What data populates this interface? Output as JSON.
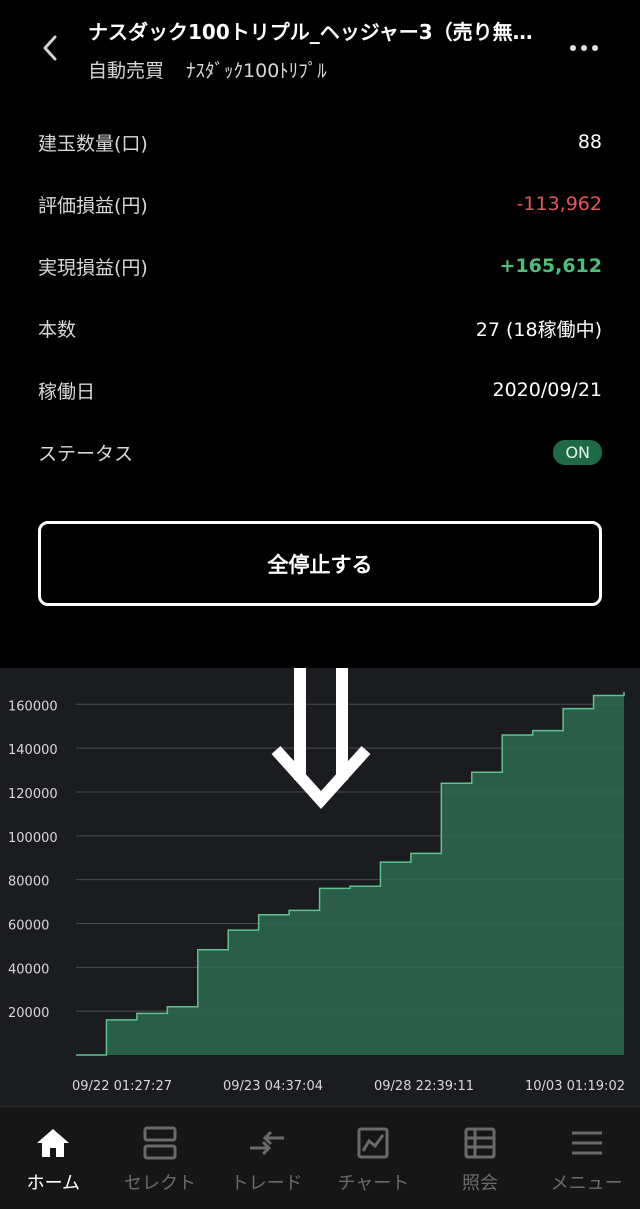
{
  "header": {
    "title": "ナスダック100トリプル_ヘッジャー3（売り無…",
    "subtitle_type": "自動売買",
    "subtitle_name": "ﾅｽﾀﾞｯｸ100ﾄﾘﾌﾟﾙ",
    "back_icon": "chevron-left-icon",
    "more_icon": "more-vertical-icon"
  },
  "info": [
    {
      "label": "建玉数量(口)",
      "value": "88",
      "color": "#ffffff"
    },
    {
      "label": "評価損益(円)",
      "value": "-113,962",
      "color": "#e8535a"
    },
    {
      "label": "実現損益(円)",
      "value": "+165,612",
      "color": "#4cc07a"
    },
    {
      "label": "本数",
      "value": "27 (18稼働中)",
      "color": "#ffffff"
    },
    {
      "label": "稼働日",
      "value": "2020/09/21",
      "color": "#ffffff"
    }
  ],
  "status": {
    "label": "ステータス",
    "badge": "ON",
    "badge_color": "#1e6a45"
  },
  "stop_button": "全停止する",
  "chart_data": {
    "type": "area",
    "y_ticks": [
      "20000",
      "40000",
      "60000",
      "80000",
      "100000",
      "120000",
      "140000",
      "160000"
    ],
    "x_ticks": [
      "09/22 01:27:27",
      "09/23 04:37:04",
      "09/28 22:39:11",
      "10/03 01:19:02"
    ],
    "ylim": [
      0,
      165612
    ],
    "grid": true,
    "fill_color": "#2e6a50",
    "line_color": "#5cc48e",
    "annotation": "down-arrow",
    "values": [
      0,
      16000,
      19000,
      22000,
      48000,
      57000,
      64000,
      66000,
      76000,
      77000,
      88000,
      92000,
      124000,
      129000,
      146000,
      148000,
      158000,
      164000,
      165612
    ]
  },
  "nav": [
    {
      "label": "ホーム",
      "icon": "home-icon",
      "active": true
    },
    {
      "label": "セレクト",
      "icon": "select-icon",
      "active": false
    },
    {
      "label": "トレード",
      "icon": "trade-icon",
      "active": false
    },
    {
      "label": "チャート",
      "icon": "chart-icon",
      "active": false
    },
    {
      "label": "照会",
      "icon": "inquiry-icon",
      "active": false
    },
    {
      "label": "メニュー",
      "icon": "menu-icon",
      "active": false
    }
  ]
}
